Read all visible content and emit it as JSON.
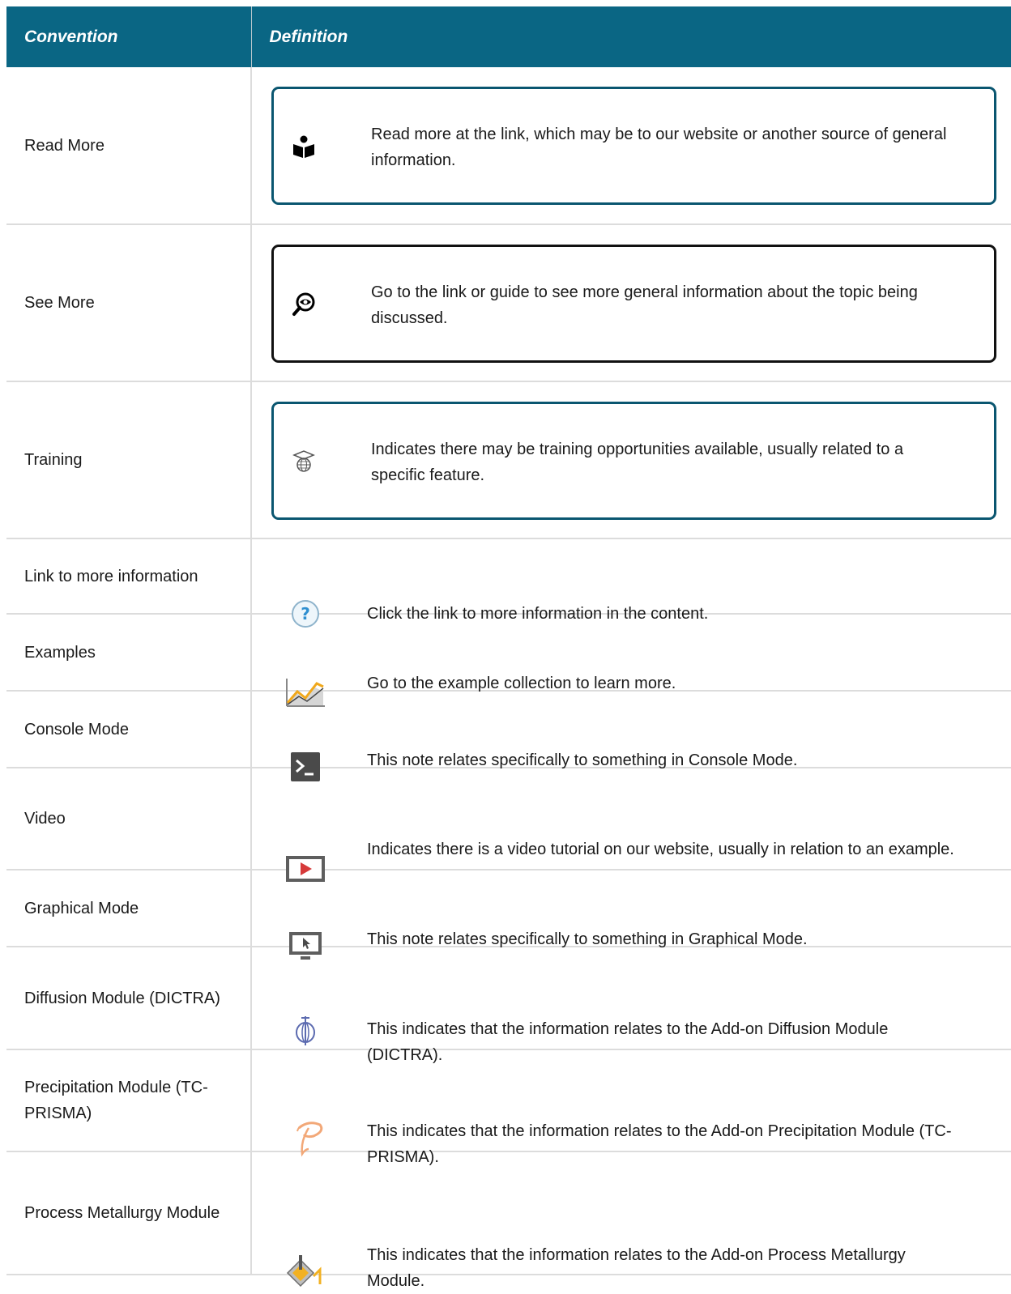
{
  "table": {
    "headers": {
      "convention": "Convention",
      "definition": "Definition"
    },
    "callout_rows": [
      {
        "convention": "Read More",
        "definition": "Read more at the link, which may be to our website or another source of general information.",
        "icon": "book-reader-icon"
      },
      {
        "convention": "See More",
        "definition": "Go to the link or guide to see more general information about the topic being discussed.",
        "icon": "magnifier-eye-icon"
      },
      {
        "convention": "Training",
        "definition": "Indicates there may be training opportunities available, usually related to a specific feature.",
        "icon": "graduation-globe-icon"
      }
    ],
    "rows": [
      {
        "convention": "Link to more information",
        "definition": "Click the link to more information in the content.",
        "icon": "question-circle-icon"
      },
      {
        "convention": "Examples",
        "definition": "Go to the example collection to learn more.",
        "icon": "line-chart-icon"
      },
      {
        "convention": "Console Mode",
        "definition": "This note relates specifically to something in Console Mode.",
        "icon": "terminal-prompt-icon"
      },
      {
        "convention": "Video",
        "definition": "Indicates there is a video tutorial on our website, usually in relation to an example.",
        "icon": "video-play-icon"
      },
      {
        "convention": "Graphical Mode",
        "definition": "This note relates specifically to something in Graphical Mode.",
        "icon": "monitor-cursor-icon"
      },
      {
        "convention": "Diffusion Module (DICTRA)",
        "definition": "This indicates that the information relates to the Add-on Diffusion Module (DICTRA).",
        "icon": "diffusion-module-icon"
      },
      {
        "convention": "Precipitation Module (TC-PRISMA)",
        "definition": "This indicates that the information relates to the Add-on Precipitation Module (TC-PRISMA).",
        "icon": "precipitation-module-icon"
      },
      {
        "convention": "Process Metallurgy Module",
        "definition": "This indicates that the information relates to the Add-on Process Metallurgy Module.",
        "icon": "process-metallurgy-icon"
      }
    ]
  },
  "colors": {
    "header_bg": "#0a6684",
    "callout_border": "#0a5670",
    "callout_border_alt": "#111111",
    "grid": "#dcdcdc"
  }
}
